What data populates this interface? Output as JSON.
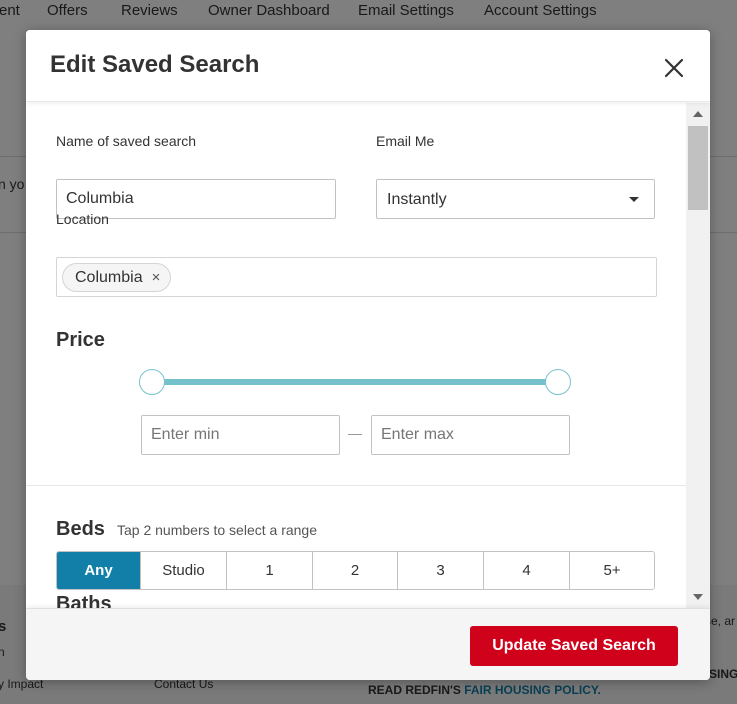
{
  "background": {
    "nav": [
      "ent",
      "Offers",
      "Reviews",
      "Owner Dashboard",
      "Email Settings",
      "Account Settings"
    ],
    "left_fragment": "n yo",
    "footer_left": [
      "s",
      "n",
      "y Impact"
    ],
    "footer_mid": "Contact Us",
    "footer_right_top": "se, ar",
    "footer_right_mid": "SING",
    "fair_housing_prefix": "READ REDFIN'S ",
    "fair_housing_link": "FAIR HOUSING POLICY."
  },
  "modal": {
    "title": "Edit Saved Search",
    "close_icon": "close-icon",
    "name_label": "Name of saved search",
    "name_value": "Columbia",
    "email_label": "Email Me",
    "email_value": "Instantly",
    "location_label": "Location",
    "location_chip": "Columbia",
    "location_chip_remove": "×",
    "price_title": "Price",
    "price_min_placeholder": "Enter min",
    "price_max_placeholder": "Enter max",
    "beds_title": "Beds",
    "beds_hint": "Tap 2 numbers to select a range",
    "beds_options": [
      "Any",
      "Studio",
      "1",
      "2",
      "3",
      "4",
      "5+"
    ],
    "beds_selected": "Any",
    "baths_title": "Baths",
    "submit_label": "Update Saved Search"
  },
  "colors": {
    "accent": "#127fa8",
    "slider": "#74c1cc",
    "primary_button": "#d0021b",
    "fair_housing_link": "#127fa8"
  }
}
